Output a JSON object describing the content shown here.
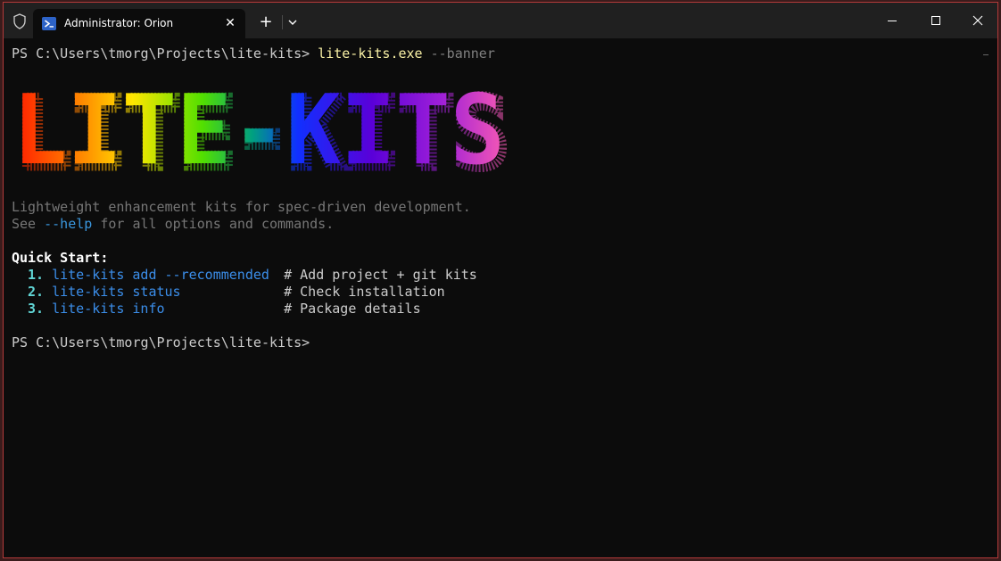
{
  "window": {
    "tab_title": "Administrator: Orion",
    "new_tab_label": "+",
    "dropdown_label": "⌄",
    "close_tab_label": "✕"
  },
  "terminal": {
    "prompt": "PS C:\\Users\\tmorg\\Projects\\lite-kits> ",
    "command": "lite-kits.exe",
    "command_arg": " --banner",
    "banner_text": "LITE-KITS",
    "description": "Lightweight enhancement kits for spec-driven development.",
    "see_prefix": "See ",
    "see_flag": "--help",
    "see_suffix": " for all options and commands.",
    "quick_start_title": "Quick Start:",
    "steps": [
      {
        "num": "1.",
        "cmd": "lite-kits add --recommended",
        "comment": "# Add project + git kits"
      },
      {
        "num": "2.",
        "cmd": "lite-kits status",
        "comment": "# Check installation"
      },
      {
        "num": "3.",
        "cmd": "lite-kits info",
        "comment": "# Package details"
      }
    ],
    "final_prompt": "PS C:\\Users\\tmorg\\Projects\\lite-kits>"
  },
  "colors": {
    "background": "#0c0c0c",
    "titlebar": "#202020",
    "command": "#f9f1a5",
    "step_number": "#61d6d6",
    "step_command": "#3b8eea",
    "border": "#b33a3a"
  },
  "icons": [
    "shield-icon",
    "powershell-icon",
    "close-icon",
    "plus-icon",
    "chevron-down-icon",
    "minimize-icon",
    "maximize-icon",
    "window-close-icon"
  ]
}
